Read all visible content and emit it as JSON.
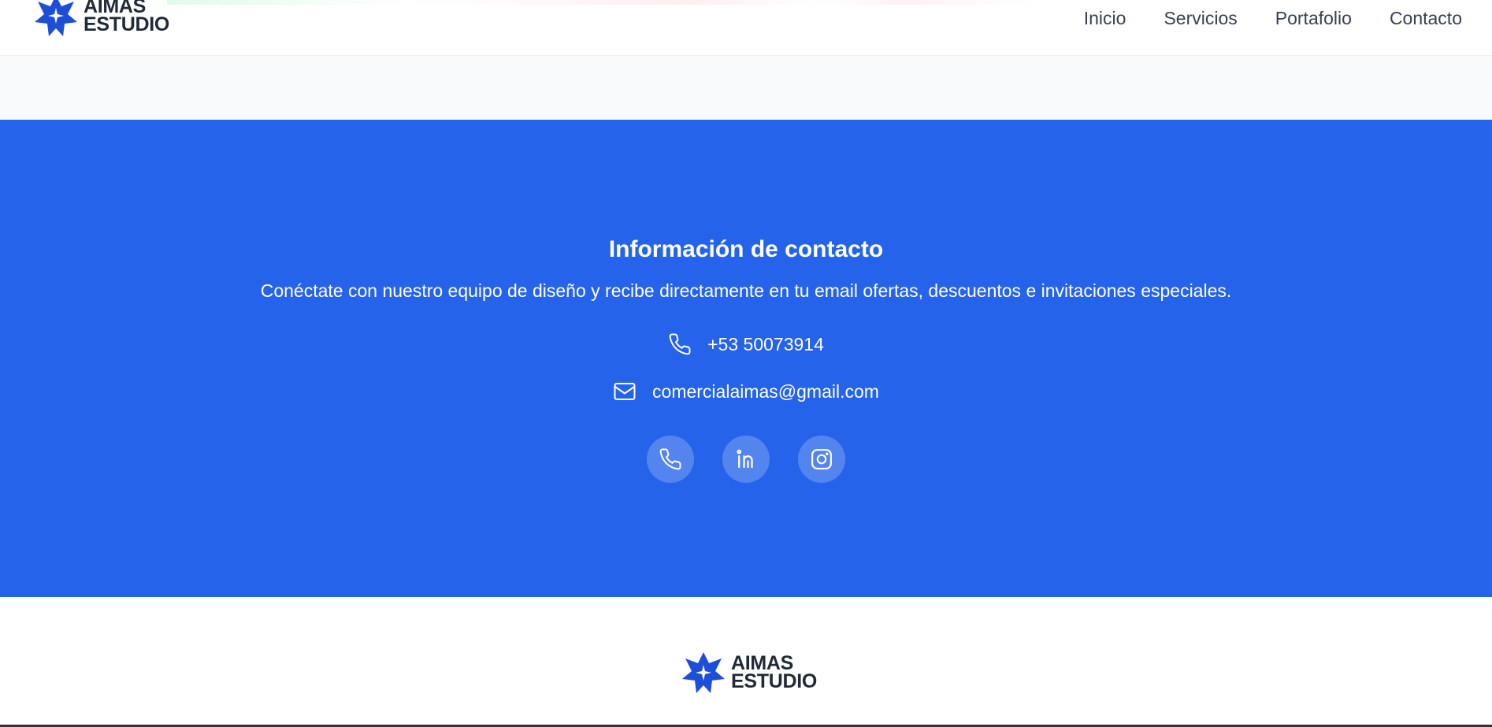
{
  "brand": {
    "line1": "AIMAS",
    "line2": "ESTUDIO",
    "color": "#1d4ed8"
  },
  "nav": {
    "items": [
      {
        "label": "Inicio"
      },
      {
        "label": "Servicios"
      },
      {
        "label": "Portafolio"
      },
      {
        "label": "Contacto"
      }
    ]
  },
  "contact": {
    "title": "Información de contacto",
    "subtitle": "Conéctate con nuestro equipo de diseño y recibe directamente en tu email ofertas, descuentos e invitaciones especiales.",
    "phone": "+53 50073914",
    "email": "comercialaimas@gmail.com",
    "background": "#2563eb",
    "socials": [
      {
        "icon": "phone-icon"
      },
      {
        "icon": "linkedin-icon"
      },
      {
        "icon": "instagram-icon"
      }
    ]
  },
  "footer": {
    "brand_line1": "AIMAS",
    "brand_line2": "ESTUDIO"
  }
}
